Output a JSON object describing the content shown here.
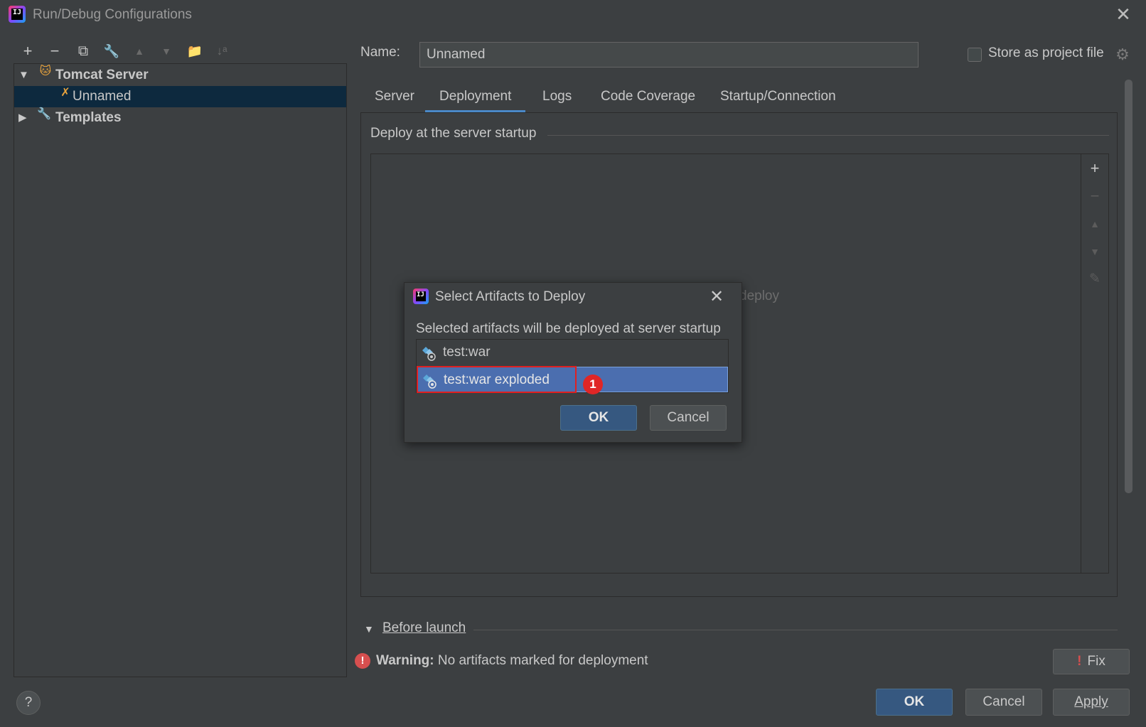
{
  "window": {
    "title": "Run/Debug Configurations",
    "logo_text": "IJ"
  },
  "toolbar": {
    "add": "+",
    "remove": "−",
    "copy": "⧉",
    "edit_templates": "🔧",
    "move_up": "▲",
    "move_down": "▼",
    "folder": "📁",
    "sort": "↓ᵃ"
  },
  "tree": {
    "groups": [
      {
        "label": "Tomcat Server",
        "expanded": true
      },
      {
        "label": "Unnamed",
        "selected": true
      },
      {
        "label": "Templates",
        "expanded": false
      }
    ]
  },
  "name_field": {
    "label": "Name:",
    "value": "Unnamed"
  },
  "store_as_project_file": {
    "label": "Store as project file",
    "checked": false
  },
  "tabs": [
    {
      "label": "Server"
    },
    {
      "label": "Deployment",
      "active": true
    },
    {
      "label": "Logs"
    },
    {
      "label": "Code Coverage"
    },
    {
      "label": "Startup/Connection"
    }
  ],
  "deployment": {
    "header": "Deploy at the server startup",
    "empty_text": "deploy"
  },
  "before_launch": {
    "label": "Before launch"
  },
  "warning": {
    "prefix": "Warning:",
    "message": "No artifacts marked for deployment",
    "fix_label": "Fix"
  },
  "buttons": {
    "help": "?",
    "ok": "OK",
    "cancel": "Cancel",
    "apply": "Apply"
  },
  "dialog": {
    "title": "Select Artifacts to Deploy",
    "description": "Selected artifacts will be deployed at server startup",
    "artifacts": [
      {
        "label": "test:war",
        "selected": false
      },
      {
        "label": "test:war exploded",
        "selected": true
      }
    ],
    "ok": "OK",
    "cancel": "Cancel",
    "step_badge": "1"
  },
  "colors": {
    "background": "#3c3f41",
    "selection": "#0d293e",
    "accent": "#4a88c7",
    "primary_button": "#365880",
    "list_selection": "#4b6eaf",
    "annotation_red": "#e02020"
  }
}
